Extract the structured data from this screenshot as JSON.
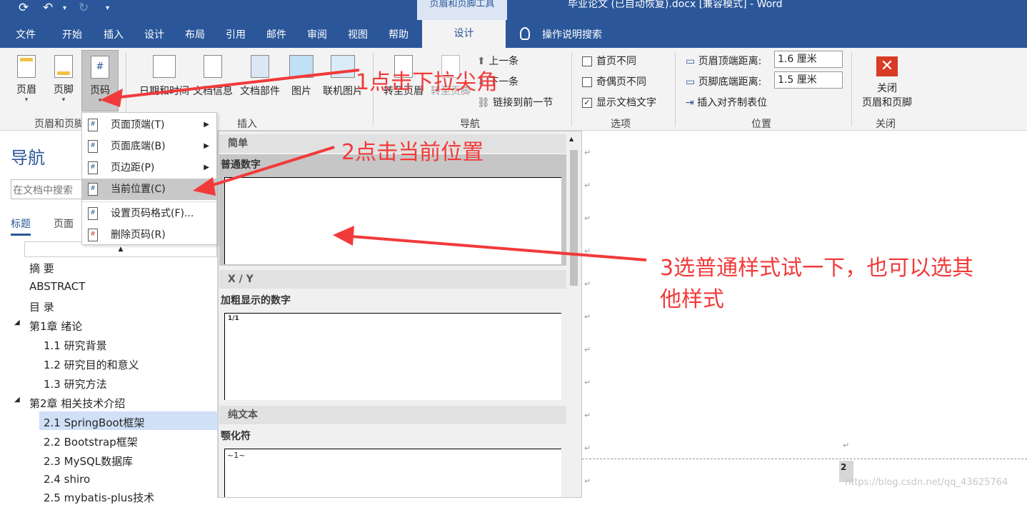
{
  "titlebar": {
    "context_tools": "页眉和页脚工具",
    "window_title": "毕业论文 (已自动恢复).docx [兼容模式] - Word"
  },
  "menubar": {
    "items": [
      "文件",
      "开始",
      "插入",
      "设计",
      "布局",
      "引用",
      "邮件",
      "审阅",
      "视图",
      "帮助"
    ],
    "active_tab": "设计",
    "tell_me": "操作说明搜索"
  },
  "ribbon": {
    "header_label": "页眉",
    "footer_label": "页脚",
    "page_number_label": "页码",
    "group_header_footer": "页眉和页脚",
    "date_time": "日期和时间",
    "doc_info": "文档信息",
    "doc_parts": "文档部件",
    "picture": "图片",
    "online_picture": "联机图片",
    "group_insert": "插入",
    "goto_header": "转至页眉",
    "goto_footer": "转至页脚",
    "prev": "上一条",
    "next": "下一条",
    "link_prev": "链接到前一节",
    "group_nav": "导航",
    "opt_first": "首页不同",
    "opt_oddeven": "奇偶页不同",
    "opt_show": "显示文档文字",
    "group_options": "选项",
    "header_dist_label": "页眉顶端距离:",
    "header_dist": "1.6 厘米",
    "footer_dist_label": "页脚底端距离:",
    "footer_dist": "1.5 厘米",
    "insert_tab": "插入对齐制表位",
    "group_position": "位置",
    "close_label_1": "关闭",
    "close_label_2": "页眉和页脚",
    "group_close": "关闭"
  },
  "dropdown": {
    "items": [
      "页面顶端(T)",
      "页面底端(B)",
      "页边距(P)",
      "当前位置(C)",
      "设置页码格式(F)...",
      "删除页码(R)"
    ]
  },
  "gallery": {
    "h1": "简单",
    "l1": "普通数字",
    "h2": "X / Y",
    "l2": "加粗显示的数字",
    "sample2": "1/1",
    "h3": "纯文本",
    "l3": "颚化符",
    "sample3": "~1~"
  },
  "nav": {
    "title": "导航",
    "search_placeholder": "在文档中搜索",
    "tab_headings": "标题",
    "tab_pages": "页面",
    "items": [
      "摘 要",
      "ABSTRACT",
      "目 录",
      "第1章 绪论",
      "1.1 研究背景",
      "1.2 研究目的和意义",
      "1.3 研究方法",
      "第2章 相关技术介绍",
      "2.1 SpringBoot框架",
      "2.2 Bootstrap框架",
      "2.3 MySQL数据库",
      "2.4 shiro",
      "2.5 mybatis-plus技术"
    ]
  },
  "document": {
    "page_number": "2",
    "watermark": "https://blog.csdn.net/qq_43625764"
  },
  "annotations": {
    "a1": "1点击下拉尖角",
    "a2": "2点击当前位置",
    "a3_line1": "3选普通样式试一下，也可以选其",
    "a3_line2": "他样式"
  }
}
